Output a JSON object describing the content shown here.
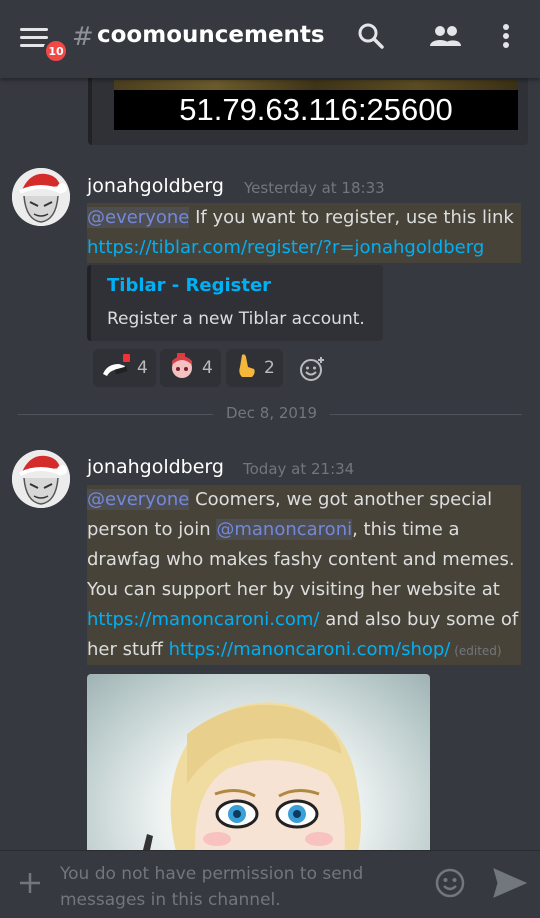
{
  "header": {
    "badge_count": "10",
    "hash": "#",
    "channel_name": "coomouncements"
  },
  "top_embed": {
    "ip_text": "51.79.63.116:25600"
  },
  "messages": [
    {
      "username": "jonahgoldberg",
      "timestamp": "Yesterday at 18:33",
      "mention": "@everyone",
      "text": " If you want to register, use this link ",
      "link": "https://tiblar.com/register/?r=jonahgoldberg",
      "embed": {
        "title": "Tiblar - Register",
        "description": "Register a new Tiblar account."
      },
      "reactions": [
        {
          "icon": "vape-emoji-icon",
          "count": "4"
        },
        {
          "icon": "anime-girl-emoji-icon",
          "count": "4"
        },
        {
          "icon": "pointing-hand-emoji-icon",
          "count": "2"
        }
      ]
    },
    {
      "username": "jonahgoldberg",
      "timestamp": "Today at 21:34",
      "mention": "@everyone",
      "line1_rest": " Coomers, we got another special",
      "line2_pre": "person to join ",
      "mention2": "@manoncaroni",
      "line2_post": ", this time a",
      "line3": "drawfag who makes fashy content and memes.",
      "line4": "You can support her by visiting her website at",
      "link1": "https://manoncaroni.com/",
      "line5_post": " and also buy some of",
      "line6_pre": "her stuff  ",
      "link2": "https://manoncaroni.com/shop/",
      "edited": " (edited)"
    }
  ],
  "date_divider": "Dec 8, 2019",
  "input": {
    "placeholder": "You do not have permission to send messages in this channel."
  }
}
